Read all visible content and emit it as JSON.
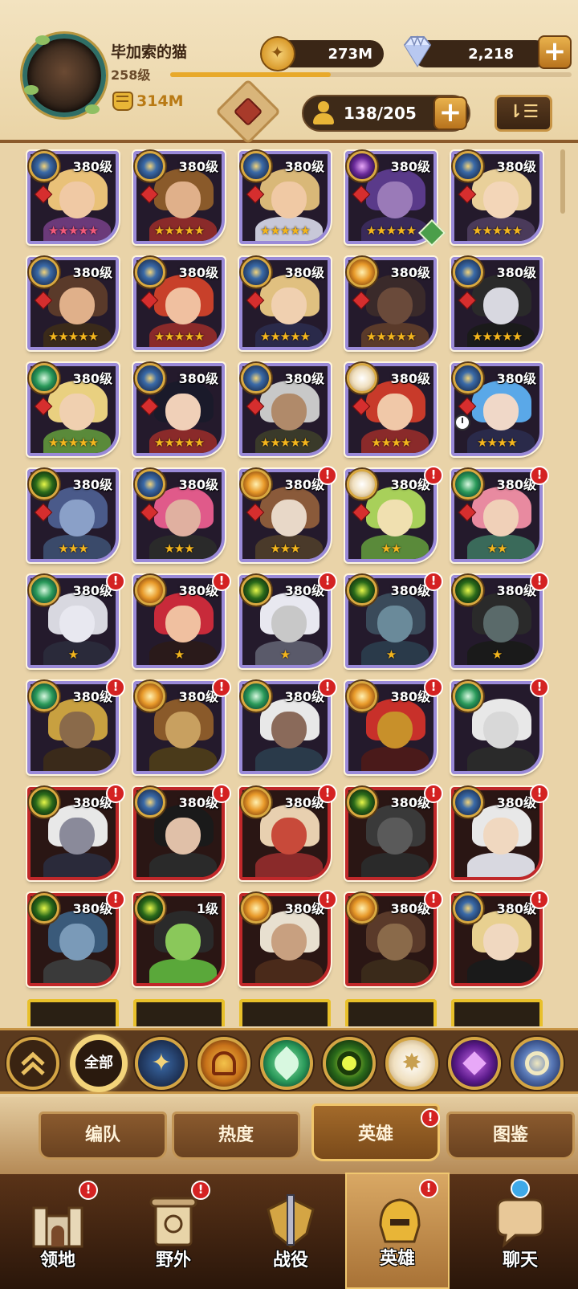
{
  "player": {
    "name": "毕加索的猫",
    "level": "258级",
    "xp_fraction": 0.4,
    "power": "314M"
  },
  "resources": {
    "gold": "273M",
    "gems": "2,218",
    "plus_label": "+",
    "roster": "138/205"
  },
  "sort_label": "⇂☰",
  "heroes": [
    {
      "level": "380级",
      "stars": "★★★★★",
      "star_color": "pink",
      "frame": "purple",
      "faction": "blue-star",
      "alert": false,
      "palette": [
        "#f0c9a4",
        "#e9c178",
        "#6b3a7a"
      ]
    },
    {
      "level": "380级",
      "stars": "★★★★★",
      "star_color": "gold",
      "frame": "purple",
      "faction": "blue-star",
      "alert": false,
      "palette": [
        "#e0b08a",
        "#8a5a2a",
        "#8a2a2a"
      ]
    },
    {
      "level": "380级",
      "stars": "★★★★★",
      "star_color": "gold",
      "frame": "purple",
      "faction": "blue-star",
      "alert": false,
      "palette": [
        "#f0c9a4",
        "#d9b878",
        "#c8c8d8"
      ]
    },
    {
      "level": "380级",
      "stars": "★★★★★",
      "star_color": "gold",
      "frame": "purple",
      "faction": "purple",
      "alert": false,
      "palette": [
        "#9a7ab8",
        "#5a3a8a",
        "#3a2a5a"
      ]
    },
    {
      "level": "380级",
      "stars": "★★★★★",
      "star_color": "gold",
      "frame": "purple",
      "faction": "blue-star",
      "alert": false,
      "palette": [
        "#f3d6b8",
        "#e9d09a",
        "#4a3a5a"
      ]
    },
    {
      "level": "380级",
      "stars": "★★★★★",
      "star_color": "gold",
      "frame": "purple",
      "faction": "blue-star",
      "alert": false,
      "palette": [
        "#e0b08a",
        "#5a3a2a",
        "#3a2a1a"
      ]
    },
    {
      "level": "380级",
      "stars": "★★★★★",
      "star_color": "gold",
      "frame": "purple",
      "faction": "blue-star",
      "alert": false,
      "palette": [
        "#f0c0a0",
        "#c8402a",
        "#8a2a2a"
      ]
    },
    {
      "level": "380级",
      "stars": "★★★★★",
      "star_color": "gold",
      "frame": "purple",
      "faction": "blue-star",
      "alert": false,
      "palette": [
        "#f0d0b0",
        "#e0c080",
        "#2a2a4a"
      ]
    },
    {
      "level": "380级",
      "stars": "★★★★★",
      "star_color": "gold",
      "frame": "purple",
      "faction": "orange",
      "alert": false,
      "palette": [
        "#6a4a3a",
        "#3a2a2a",
        "#5a3a2a"
      ]
    },
    {
      "level": "380级",
      "stars": "★★★★★",
      "star_color": "gold",
      "frame": "purple",
      "faction": "blue-star",
      "alert": false,
      "palette": [
        "#d8d8e0",
        "#2a2a2a",
        "#1a1a1a"
      ]
    },
    {
      "level": "380级",
      "stars": "★★★★★",
      "star_color": "gold",
      "frame": "purple",
      "faction": "green",
      "alert": false,
      "palette": [
        "#f0d0b0",
        "#e9d080",
        "#5a8a3a"
      ]
    },
    {
      "level": "380级",
      "stars": "★★★★★",
      "star_color": "gold",
      "frame": "purple",
      "faction": "blue-star",
      "alert": false,
      "palette": [
        "#f0d0b8",
        "#1a1a2a",
        "#8a2a2a"
      ]
    },
    {
      "level": "380级",
      "stars": "★★★★★",
      "star_color": "gold",
      "frame": "purple",
      "faction": "blue-star",
      "alert": false,
      "palette": [
        "#b08a6a",
        "#c8c8c8",
        "#3a3a2a"
      ]
    },
    {
      "level": "380级",
      "stars": "★★★★",
      "star_color": "gold",
      "frame": "purple",
      "faction": "white-star",
      "alert": false,
      "palette": [
        "#f0c8a8",
        "#c83a2a",
        "#8a2a2a"
      ]
    },
    {
      "level": "380级",
      "stars": "★★★★",
      "star_color": "gold",
      "frame": "purple",
      "faction": "blue-star",
      "alert": false,
      "palette": [
        "#f0d8c8",
        "#5aa8e8",
        "#2a2a4a"
      ]
    },
    {
      "level": "380级",
      "stars": "★★★",
      "star_color": "gold",
      "frame": "purple",
      "faction": "green-eye",
      "alert": false,
      "palette": [
        "#8aa0c8",
        "#4a5a8a",
        "#3a4a6a"
      ]
    },
    {
      "level": "380级",
      "stars": "★★★",
      "star_color": "gold",
      "frame": "purple",
      "faction": "blue-star",
      "alert": false,
      "palette": [
        "#e0b0a0",
        "#e05a8a",
        "#2a2a2a"
      ]
    },
    {
      "level": "380级",
      "stars": "★★★",
      "star_color": "gold",
      "frame": "purple",
      "faction": "orange",
      "alert": true,
      "palette": [
        "#e8d8c8",
        "#8a5a3a",
        "#4a3a2a"
      ]
    },
    {
      "level": "380级",
      "stars": "★★",
      "star_color": "gold",
      "frame": "purple",
      "faction": "white-star",
      "alert": true,
      "palette": [
        "#f0e0b0",
        "#a8d05a",
        "#5a8a3a"
      ]
    },
    {
      "level": "380级",
      "stars": "★★",
      "star_color": "gold",
      "frame": "purple",
      "faction": "green",
      "alert": true,
      "palette": [
        "#f0d0b8",
        "#e88aa0",
        "#3a6a5a"
      ]
    },
    {
      "level": "380级",
      "stars": "★",
      "star_color": "gold",
      "frame": "purple",
      "faction": "green",
      "alert": true,
      "palette": [
        "#e8e8f0",
        "#d8d8e0",
        "#2a2a3a"
      ]
    },
    {
      "level": "380级",
      "stars": "★",
      "star_color": "gold",
      "frame": "purple",
      "faction": "orange",
      "alert": true,
      "palette": [
        "#f0c0a0",
        "#c82a3a",
        "#2a1a1a"
      ]
    },
    {
      "level": "380级",
      "stars": "★",
      "star_color": "gold",
      "frame": "purple",
      "faction": "green-eye",
      "alert": true,
      "palette": [
        "#c8c8c8",
        "#e8e8f0",
        "#5a5a6a"
      ]
    },
    {
      "level": "380级",
      "stars": "★",
      "star_color": "gold",
      "frame": "purple",
      "faction": "green-eye",
      "alert": true,
      "palette": [
        "#6a8a9a",
        "#3a4a5a",
        "#2a3a4a"
      ]
    },
    {
      "level": "380级",
      "stars": "★",
      "star_color": "gold",
      "frame": "purple",
      "faction": "green-eye",
      "alert": true,
      "palette": [
        "#5a6a6a",
        "#2a2a2a",
        "#1a1a1a"
      ]
    },
    {
      "level": "380级",
      "stars": "",
      "star_color": "gold",
      "frame": "purple",
      "faction": "green",
      "alert": true,
      "palette": [
        "#8a6a4a",
        "#c8a040",
        "#3a2a1a"
      ]
    },
    {
      "level": "380级",
      "stars": "",
      "star_color": "gold",
      "frame": "purple",
      "faction": "orange",
      "alert": true,
      "palette": [
        "#c8a060",
        "#8a5a2a",
        "#4a3a1a"
      ]
    },
    {
      "level": "380级",
      "stars": "",
      "star_color": "gold",
      "frame": "purple",
      "faction": "green",
      "alert": true,
      "palette": [
        "#8a6a5a",
        "#e8e8e8",
        "#2a3a4a"
      ]
    },
    {
      "level": "380级",
      "stars": "",
      "star_color": "gold",
      "frame": "purple",
      "faction": "orange",
      "alert": true,
      "palette": [
        "#c8902a",
        "#c8302a",
        "#4a1a1a"
      ]
    },
    {
      "level": "",
      "stars": "",
      "star_color": "gold",
      "frame": "purple",
      "faction": "green",
      "alert": true,
      "palette": [
        "#d8d8d8",
        "#e8e8e8",
        "#2a2a2a"
      ]
    },
    {
      "level": "380级",
      "stars": "",
      "star_color": "gold",
      "frame": "red",
      "faction": "green-eye",
      "alert": true,
      "palette": [
        "#8a8a9a",
        "#e8e8e8",
        "#2a2a3a"
      ]
    },
    {
      "level": "380级",
      "stars": "",
      "star_color": "gold",
      "frame": "red",
      "faction": "blue-star",
      "alert": true,
      "palette": [
        "#e0c0a8",
        "#1a1a1a",
        "#2a2a2a"
      ]
    },
    {
      "level": "380级",
      "stars": "",
      "star_color": "gold",
      "frame": "red",
      "faction": "orange",
      "alert": true,
      "palette": [
        "#c84a3a",
        "#e8d0b0",
        "#8a2a2a"
      ]
    },
    {
      "level": "380级",
      "stars": "",
      "star_color": "gold",
      "frame": "red",
      "faction": "green-eye",
      "alert": true,
      "palette": [
        "#5a5a5a",
        "#3a3a3a",
        "#2a2a2a"
      ]
    },
    {
      "level": "380级",
      "stars": "",
      "star_color": "gold",
      "frame": "red",
      "faction": "blue-star",
      "alert": true,
      "palette": [
        "#f0d8c0",
        "#e8e8e8",
        "#d8d8e0"
      ]
    },
    {
      "level": "380级",
      "stars": "",
      "star_color": "gold",
      "frame": "red",
      "faction": "green-eye",
      "alert": true,
      "palette": [
        "#7a9ab8",
        "#3a5a7a",
        "#3a3a3a"
      ]
    },
    {
      "level": "1级",
      "stars": "",
      "star_color": "gold",
      "frame": "red",
      "faction": "green-eye",
      "alert": false,
      "palette": [
        "#8ac85a",
        "#2a2a2a",
        "#5aa83a"
      ]
    },
    {
      "level": "380级",
      "stars": "",
      "star_color": "gold",
      "frame": "red",
      "faction": "orange",
      "alert": true,
      "palette": [
        "#c8a080",
        "#e8e0d0",
        "#4a2a1a"
      ]
    },
    {
      "level": "380级",
      "stars": "",
      "star_color": "gold",
      "frame": "red",
      "faction": "orange",
      "alert": true,
      "palette": [
        "#8a6a4a",
        "#5a3a2a",
        "#3a2a1a"
      ]
    },
    {
      "level": "380级",
      "stars": "",
      "star_color": "gold",
      "frame": "red",
      "faction": "blue-star",
      "alert": true,
      "palette": [
        "#f0d8c0",
        "#e8d090",
        "#1a1a1a"
      ]
    }
  ],
  "filters": [
    {
      "id": "up",
      "label": ""
    },
    {
      "id": "all",
      "label": "全部"
    },
    {
      "id": "lightbearer",
      "label": ""
    },
    {
      "id": "mauler",
      "label": ""
    },
    {
      "id": "wilder",
      "label": ""
    },
    {
      "id": "graveborn",
      "label": ""
    },
    {
      "id": "celestial",
      "label": ""
    },
    {
      "id": "hypogean",
      "label": ""
    },
    {
      "id": "dimensional",
      "label": ""
    }
  ],
  "tabs": [
    {
      "label": "编队",
      "active": false,
      "alert": false
    },
    {
      "label": "热度",
      "active": false,
      "alert": false
    },
    {
      "label": "英雄",
      "active": true,
      "alert": true
    },
    {
      "label": "图鉴",
      "active": false,
      "alert": false
    }
  ],
  "nav": [
    {
      "label": "领地",
      "alert": true
    },
    {
      "label": "野外",
      "alert": true
    },
    {
      "label": "战役",
      "alert": false
    },
    {
      "label": "英雄",
      "alert": true
    },
    {
      "label": "聊天",
      "alert": false
    }
  ],
  "colors": {
    "purple_frame": "#9a8ad8",
    "red_frame": "#c0282a",
    "alert_red": "#d42222",
    "gold": "#e8b537"
  }
}
